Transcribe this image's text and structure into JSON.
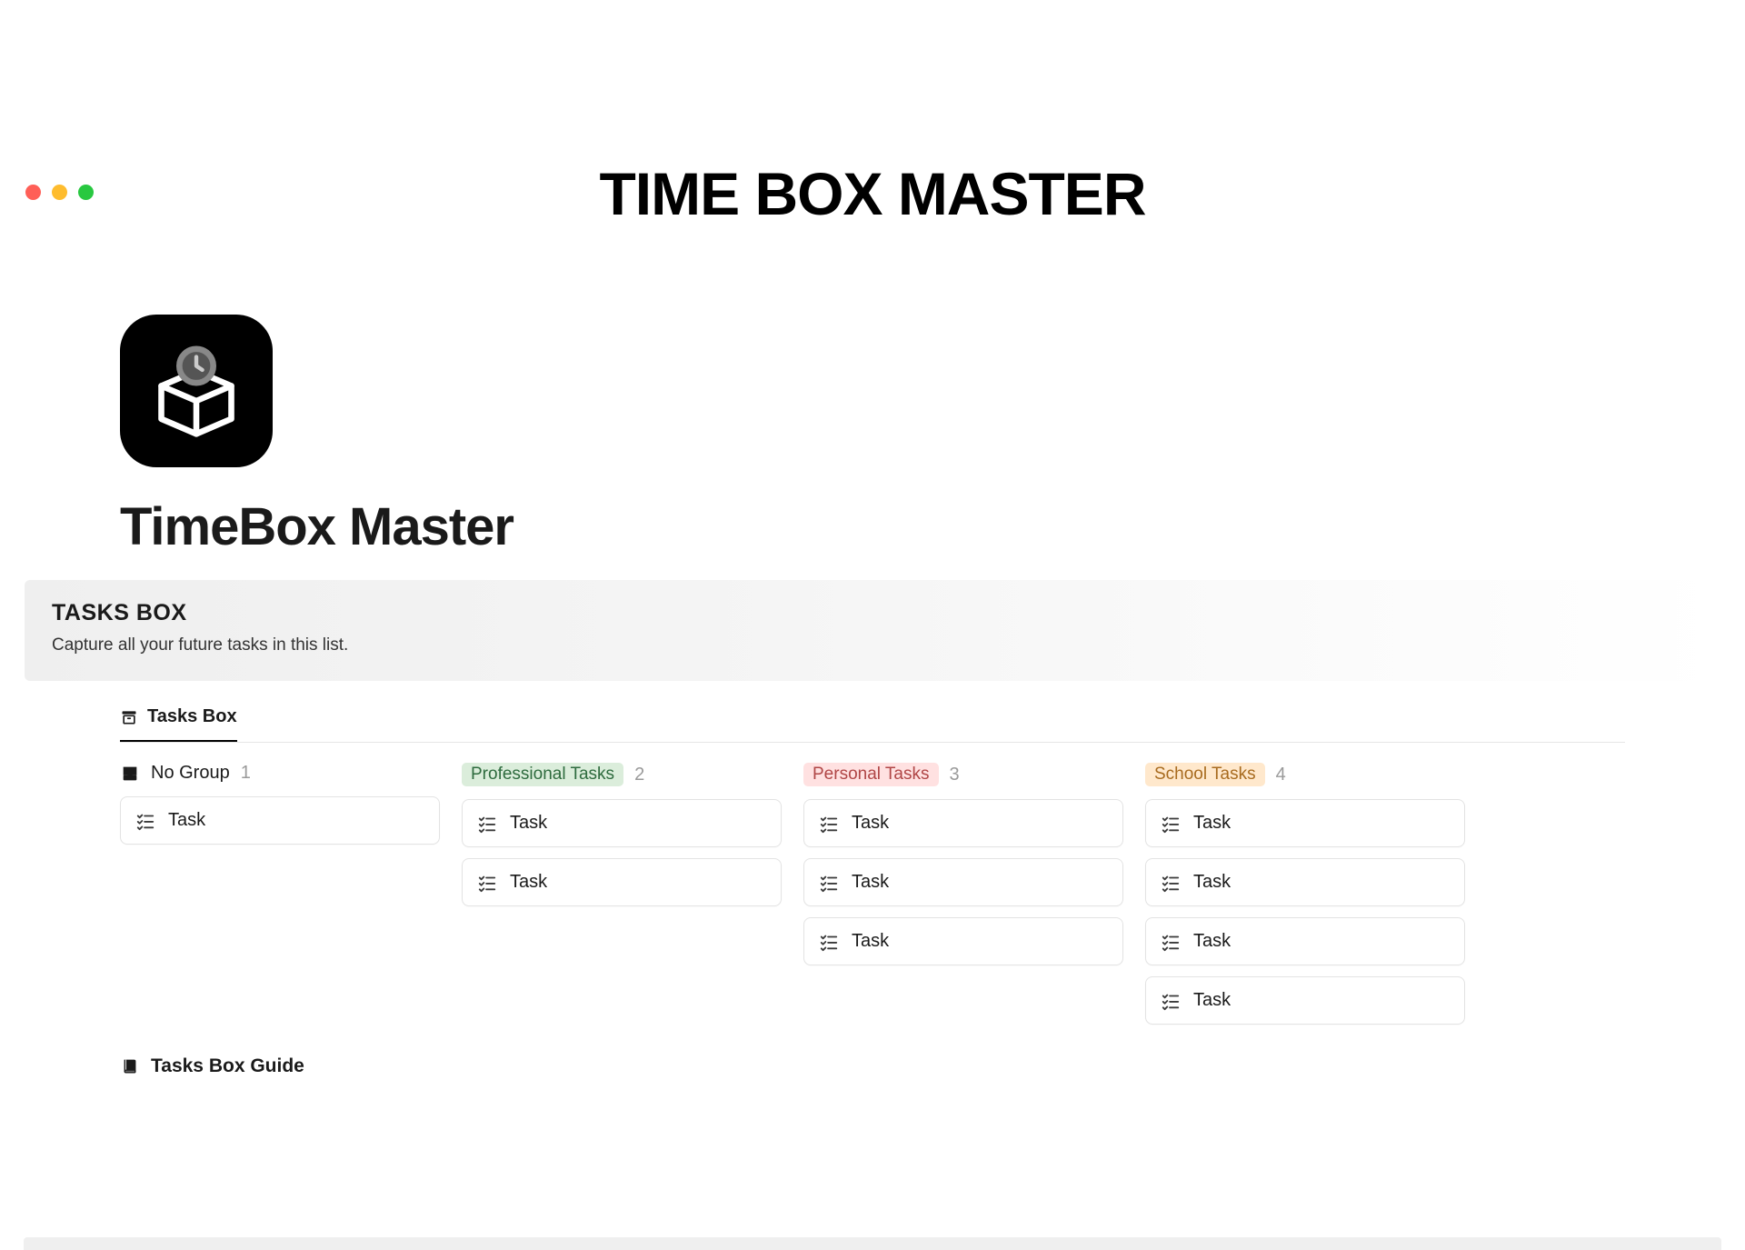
{
  "hero": {
    "title": "TIME BOX MASTER"
  },
  "page": {
    "title": "TimeBox Master"
  },
  "callout": {
    "title": "TASKS BOX",
    "subtitle": "Capture all your future tasks in this list."
  },
  "tabs": {
    "active": "Tasks Box"
  },
  "board": {
    "columns": [
      {
        "kind": "nogroup",
        "label": "No Group",
        "count": 1,
        "cards": [
          "Task"
        ]
      },
      {
        "kind": "chip",
        "chip_color": "green",
        "label": "Professional Tasks",
        "count": 2,
        "cards": [
          "Task",
          "Task"
        ]
      },
      {
        "kind": "chip",
        "chip_color": "red",
        "label": "Personal Tasks",
        "count": 3,
        "cards": [
          "Task",
          "Task",
          "Task"
        ]
      },
      {
        "kind": "chip",
        "chip_color": "orange",
        "label": "School Tasks",
        "count": 4,
        "cards": [
          "Task",
          "Task",
          "Task",
          "Task"
        ]
      }
    ]
  },
  "guide": {
    "label": "Tasks Box Guide"
  }
}
